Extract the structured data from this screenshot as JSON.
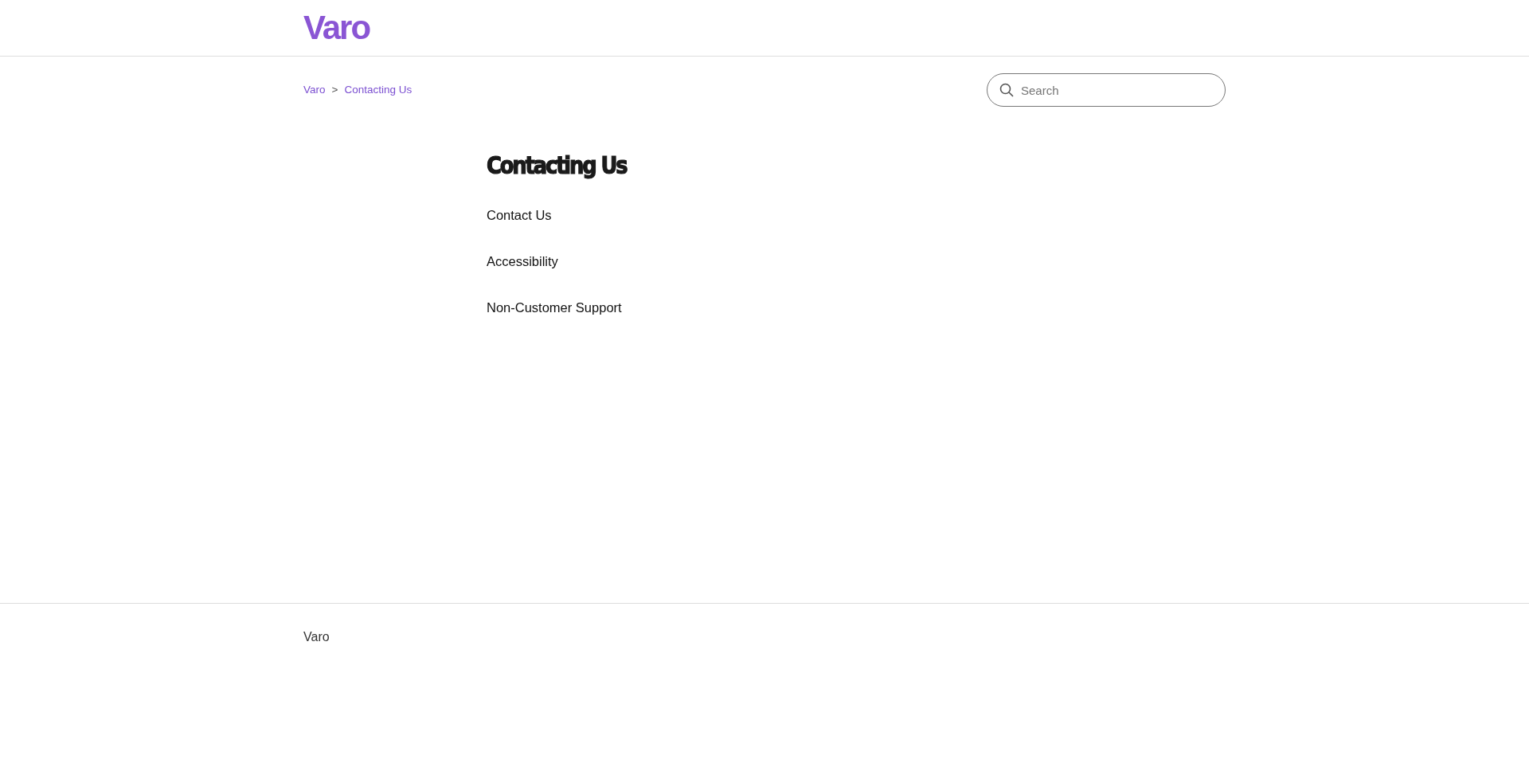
{
  "header": {
    "logo": "Varo"
  },
  "breadcrumbs": [
    {
      "label": "Varo",
      "separator": ">"
    },
    {
      "label": "Contacting Us"
    }
  ],
  "search": {
    "placeholder": "Search"
  },
  "section": {
    "title": "Contacting Us",
    "links": [
      {
        "label": "Contact Us"
      },
      {
        "label": "Accessibility"
      },
      {
        "label": "Non-Customer Support"
      }
    ]
  },
  "footer": {
    "label": "Varo"
  }
}
